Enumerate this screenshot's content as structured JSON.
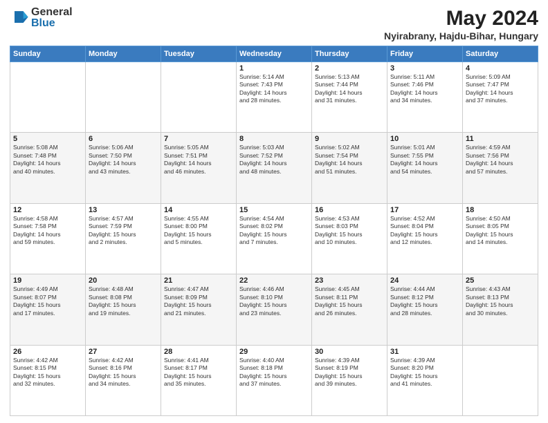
{
  "header": {
    "logo_general": "General",
    "logo_blue": "Blue",
    "month_title": "May 2024",
    "location": "Nyirabrany, Hajdu-Bihar, Hungary"
  },
  "weekdays": [
    "Sunday",
    "Monday",
    "Tuesday",
    "Wednesday",
    "Thursday",
    "Friday",
    "Saturday"
  ],
  "weeks": [
    [
      {
        "day": "",
        "info": ""
      },
      {
        "day": "",
        "info": ""
      },
      {
        "day": "",
        "info": ""
      },
      {
        "day": "1",
        "info": "Sunrise: 5:14 AM\nSunset: 7:43 PM\nDaylight: 14 hours\nand 28 minutes."
      },
      {
        "day": "2",
        "info": "Sunrise: 5:13 AM\nSunset: 7:44 PM\nDaylight: 14 hours\nand 31 minutes."
      },
      {
        "day": "3",
        "info": "Sunrise: 5:11 AM\nSunset: 7:46 PM\nDaylight: 14 hours\nand 34 minutes."
      },
      {
        "day": "4",
        "info": "Sunrise: 5:09 AM\nSunset: 7:47 PM\nDaylight: 14 hours\nand 37 minutes."
      }
    ],
    [
      {
        "day": "5",
        "info": "Sunrise: 5:08 AM\nSunset: 7:48 PM\nDaylight: 14 hours\nand 40 minutes."
      },
      {
        "day": "6",
        "info": "Sunrise: 5:06 AM\nSunset: 7:50 PM\nDaylight: 14 hours\nand 43 minutes."
      },
      {
        "day": "7",
        "info": "Sunrise: 5:05 AM\nSunset: 7:51 PM\nDaylight: 14 hours\nand 46 minutes."
      },
      {
        "day": "8",
        "info": "Sunrise: 5:03 AM\nSunset: 7:52 PM\nDaylight: 14 hours\nand 48 minutes."
      },
      {
        "day": "9",
        "info": "Sunrise: 5:02 AM\nSunset: 7:54 PM\nDaylight: 14 hours\nand 51 minutes."
      },
      {
        "day": "10",
        "info": "Sunrise: 5:01 AM\nSunset: 7:55 PM\nDaylight: 14 hours\nand 54 minutes."
      },
      {
        "day": "11",
        "info": "Sunrise: 4:59 AM\nSunset: 7:56 PM\nDaylight: 14 hours\nand 57 minutes."
      }
    ],
    [
      {
        "day": "12",
        "info": "Sunrise: 4:58 AM\nSunset: 7:58 PM\nDaylight: 14 hours\nand 59 minutes."
      },
      {
        "day": "13",
        "info": "Sunrise: 4:57 AM\nSunset: 7:59 PM\nDaylight: 15 hours\nand 2 minutes."
      },
      {
        "day": "14",
        "info": "Sunrise: 4:55 AM\nSunset: 8:00 PM\nDaylight: 15 hours\nand 5 minutes."
      },
      {
        "day": "15",
        "info": "Sunrise: 4:54 AM\nSunset: 8:02 PM\nDaylight: 15 hours\nand 7 minutes."
      },
      {
        "day": "16",
        "info": "Sunrise: 4:53 AM\nSunset: 8:03 PM\nDaylight: 15 hours\nand 10 minutes."
      },
      {
        "day": "17",
        "info": "Sunrise: 4:52 AM\nSunset: 8:04 PM\nDaylight: 15 hours\nand 12 minutes."
      },
      {
        "day": "18",
        "info": "Sunrise: 4:50 AM\nSunset: 8:05 PM\nDaylight: 15 hours\nand 14 minutes."
      }
    ],
    [
      {
        "day": "19",
        "info": "Sunrise: 4:49 AM\nSunset: 8:07 PM\nDaylight: 15 hours\nand 17 minutes."
      },
      {
        "day": "20",
        "info": "Sunrise: 4:48 AM\nSunset: 8:08 PM\nDaylight: 15 hours\nand 19 minutes."
      },
      {
        "day": "21",
        "info": "Sunrise: 4:47 AM\nSunset: 8:09 PM\nDaylight: 15 hours\nand 21 minutes."
      },
      {
        "day": "22",
        "info": "Sunrise: 4:46 AM\nSunset: 8:10 PM\nDaylight: 15 hours\nand 23 minutes."
      },
      {
        "day": "23",
        "info": "Sunrise: 4:45 AM\nSunset: 8:11 PM\nDaylight: 15 hours\nand 26 minutes."
      },
      {
        "day": "24",
        "info": "Sunrise: 4:44 AM\nSunset: 8:12 PM\nDaylight: 15 hours\nand 28 minutes."
      },
      {
        "day": "25",
        "info": "Sunrise: 4:43 AM\nSunset: 8:13 PM\nDaylight: 15 hours\nand 30 minutes."
      }
    ],
    [
      {
        "day": "26",
        "info": "Sunrise: 4:42 AM\nSunset: 8:15 PM\nDaylight: 15 hours\nand 32 minutes."
      },
      {
        "day": "27",
        "info": "Sunrise: 4:42 AM\nSunset: 8:16 PM\nDaylight: 15 hours\nand 34 minutes."
      },
      {
        "day": "28",
        "info": "Sunrise: 4:41 AM\nSunset: 8:17 PM\nDaylight: 15 hours\nand 35 minutes."
      },
      {
        "day": "29",
        "info": "Sunrise: 4:40 AM\nSunset: 8:18 PM\nDaylight: 15 hours\nand 37 minutes."
      },
      {
        "day": "30",
        "info": "Sunrise: 4:39 AM\nSunset: 8:19 PM\nDaylight: 15 hours\nand 39 minutes."
      },
      {
        "day": "31",
        "info": "Sunrise: 4:39 AM\nSunset: 8:20 PM\nDaylight: 15 hours\nand 41 minutes."
      },
      {
        "day": "",
        "info": ""
      }
    ]
  ]
}
